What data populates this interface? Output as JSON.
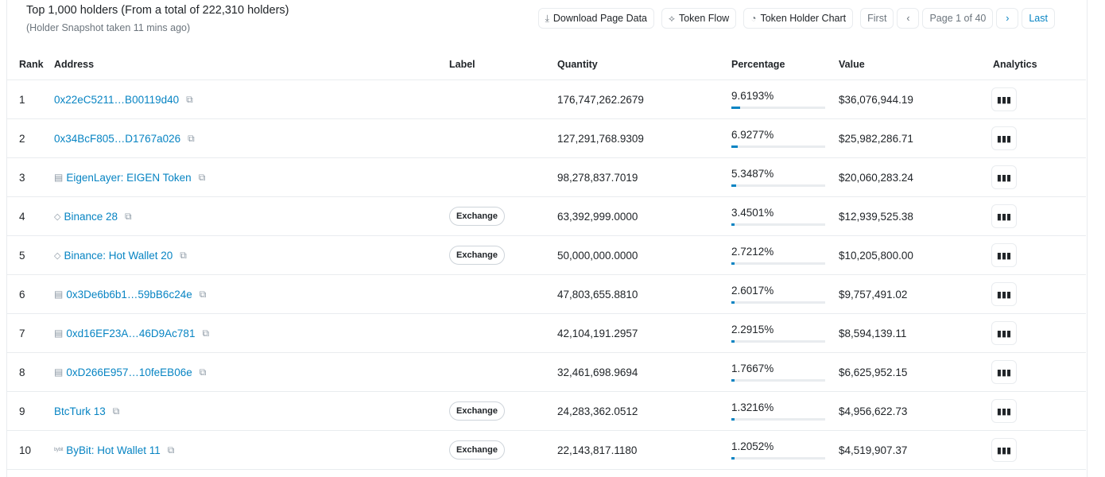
{
  "summary": {
    "title": "Top 1,000 holders (From a total of 222,310 holders)",
    "snapshot": "(Holder Snapshot taken 11 mins ago)"
  },
  "toolbar": {
    "download": "Download Page Data",
    "token_flow": "Token Flow",
    "holder_chart": "Token Holder Chart",
    "first": "First",
    "page": "Page 1 of 40",
    "last": "Last"
  },
  "columns": {
    "rank": "Rank",
    "address": "Address",
    "label": "Label",
    "quantity": "Quantity",
    "percentage": "Percentage",
    "value": "Value",
    "analytics": "Analytics"
  },
  "rows": [
    {
      "rank": "1",
      "address": "0x22eC5211…B00119d40",
      "icon": "",
      "label": "",
      "quantity": "176,747,262.2679",
      "percentage": "9.6193%",
      "pct_fraction": 0.096193,
      "value": "$36,076,944.19"
    },
    {
      "rank": "2",
      "address": "0x34BcF805…D1767a026",
      "icon": "",
      "label": "",
      "quantity": "127,291,768.9309",
      "percentage": "6.9277%",
      "pct_fraction": 0.069277,
      "value": "$25,982,286.71"
    },
    {
      "rank": "3",
      "address": "EigenLayer: EIGEN Token",
      "icon": "contract-icon",
      "label": "",
      "quantity": "98,278,837.7019",
      "percentage": "5.3487%",
      "pct_fraction": 0.053487,
      "value": "$20,060,283.24"
    },
    {
      "rank": "4",
      "address": "Binance 28",
      "icon": "binance-icon",
      "label": "Exchange",
      "quantity": "63,392,999.0000",
      "percentage": "3.4501%",
      "pct_fraction": 0.034501,
      "value": "$12,939,525.38"
    },
    {
      "rank": "5",
      "address": "Binance: Hot Wallet 20",
      "icon": "binance-icon",
      "label": "Exchange",
      "quantity": "50,000,000.0000",
      "percentage": "2.7212%",
      "pct_fraction": 0.027212,
      "value": "$10,205,800.00"
    },
    {
      "rank": "6",
      "address": "0x3De6b6b1…59bB6c24e",
      "icon": "contract-icon",
      "label": "",
      "quantity": "47,803,655.8810",
      "percentage": "2.6017%",
      "pct_fraction": 0.026017,
      "value": "$9,757,491.02"
    },
    {
      "rank": "7",
      "address": "0xd16EF23A…46D9Ac781",
      "icon": "contract-icon",
      "label": "",
      "quantity": "42,104,191.2957",
      "percentage": "2.2915%",
      "pct_fraction": 0.022915,
      "value": "$8,594,139.11"
    },
    {
      "rank": "8",
      "address": "0xD266E957…10feEB06e",
      "icon": "contract-icon",
      "label": "",
      "quantity": "32,461,698.9694",
      "percentage": "1.7667%",
      "pct_fraction": 0.017667,
      "value": "$6,625,952.15"
    },
    {
      "rank": "9",
      "address": "BtcTurk 13",
      "icon": "",
      "label": "Exchange",
      "quantity": "24,283,362.0512",
      "percentage": "1.3216%",
      "pct_fraction": 0.013216,
      "value": "$4,956,622.73"
    },
    {
      "rank": "10",
      "address": "ByBit: Hot Wallet 11",
      "icon": "bybit-icon",
      "label": "Exchange",
      "quantity": "22,143,817.1180",
      "percentage": "1.2052%",
      "pct_fraction": 0.012052,
      "value": "$4,519,907.37"
    }
  ]
}
